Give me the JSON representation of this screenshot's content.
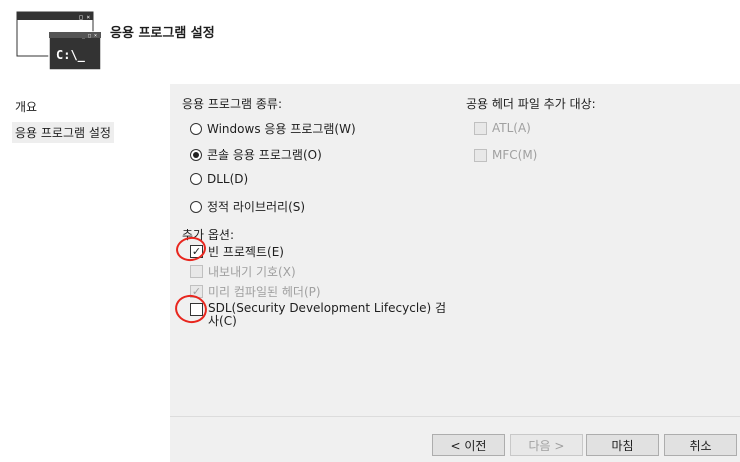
{
  "header": {
    "title": "응용 프로그램 설정",
    "icon_text": "C:\\_"
  },
  "sidebar": {
    "items": [
      {
        "label": "개요"
      },
      {
        "label": "응용 프로그램 설정"
      }
    ]
  },
  "app_type": {
    "label": "응용 프로그램 종류:",
    "options": [
      {
        "label": "Windows 응용 프로그램(W)",
        "selected": false
      },
      {
        "label": "콘솔 응용 프로그램(O)",
        "selected": true
      },
      {
        "label": "DLL(D)",
        "selected": false
      },
      {
        "label": "정적 라이브러리(S)",
        "selected": false
      }
    ]
  },
  "common_headers": {
    "label": "공용 헤더 파일 추가 대상:",
    "options": [
      {
        "label": "ATL(A)",
        "checked": false,
        "enabled": false
      },
      {
        "label": "MFC(M)",
        "checked": false,
        "enabled": false
      }
    ]
  },
  "extra_options": {
    "label": "추가 옵션:",
    "options": [
      {
        "label": "빈 프로젝트(E)",
        "checked": true,
        "enabled": true
      },
      {
        "label": "내보내기 기호(X)",
        "checked": false,
        "enabled": false
      },
      {
        "label": "미리 컴파일된 헤더(P)",
        "checked": true,
        "enabled": false
      },
      {
        "label": "SDL(Security Development Lifecycle) 검",
        "label_line2": "사(C)",
        "checked": false,
        "enabled": true
      }
    ]
  },
  "footer": {
    "prev_label": "< 이전",
    "next_label": "다음 >",
    "finish_label": "마침",
    "cancel_label": "취소"
  },
  "colors": {
    "annotation": "#e8261e",
    "panel_bg": "#f0f0f0"
  }
}
